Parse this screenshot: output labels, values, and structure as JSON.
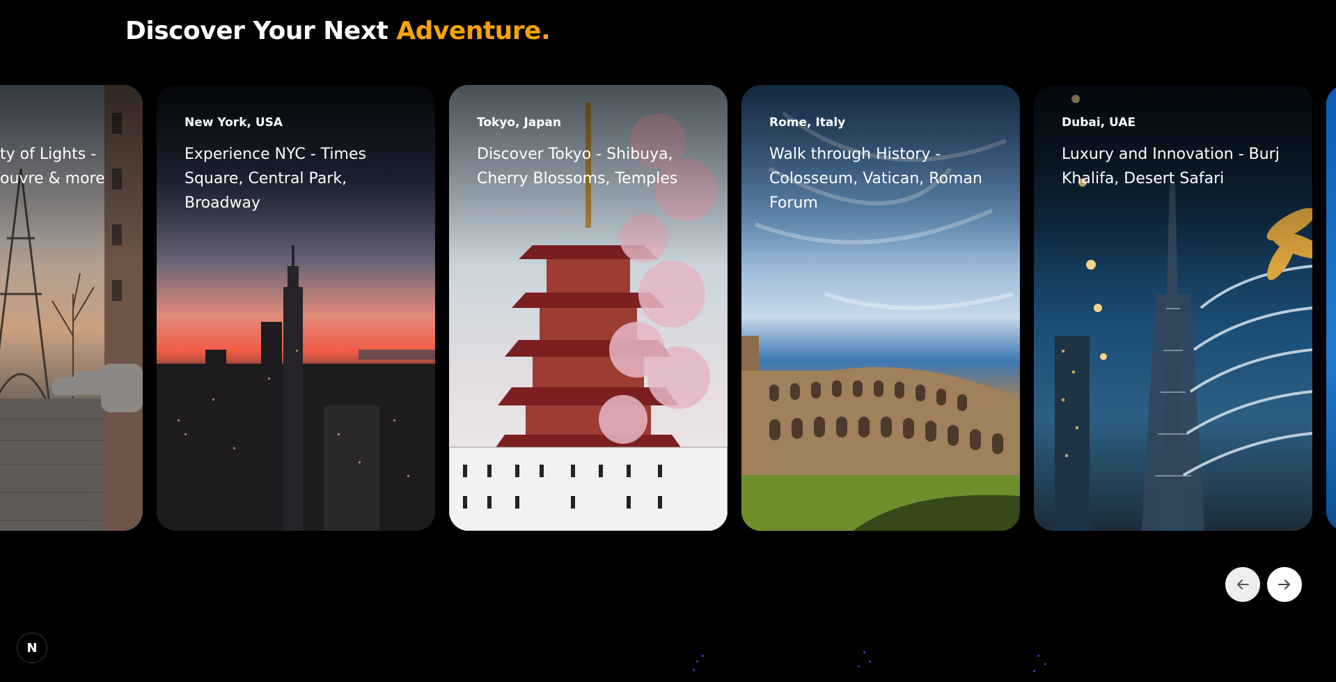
{
  "heading": {
    "prefix": "Discover Your Next ",
    "accent": "Adventure.",
    "accent_color": "#f5a20b"
  },
  "cards": [
    {
      "location": "",
      "title": "City of Lights - Eiffel Tower, Louvre & more",
      "title_visible": "ty of Lights -\nouvre & more"
    },
    {
      "location": "New York, USA",
      "title": "Experience NYC - Times Square, Central Park, Broadway"
    },
    {
      "location": "Tokyo, Japan",
      "title": "Discover Tokyo - Shibuya, Cherry Blossoms, Temples"
    },
    {
      "location": "Rome, Italy",
      "title": "Walk through History - Colosseum, Vatican, Roman Forum"
    },
    {
      "location": "Dubai, UAE",
      "title": "Luxury and Innovation - Burj Khalifa, Desert Safari"
    }
  ],
  "nav": {
    "prev_icon": "arrow-left-icon",
    "next_icon": "arrow-right-icon"
  },
  "badge": {
    "letter": "N"
  }
}
